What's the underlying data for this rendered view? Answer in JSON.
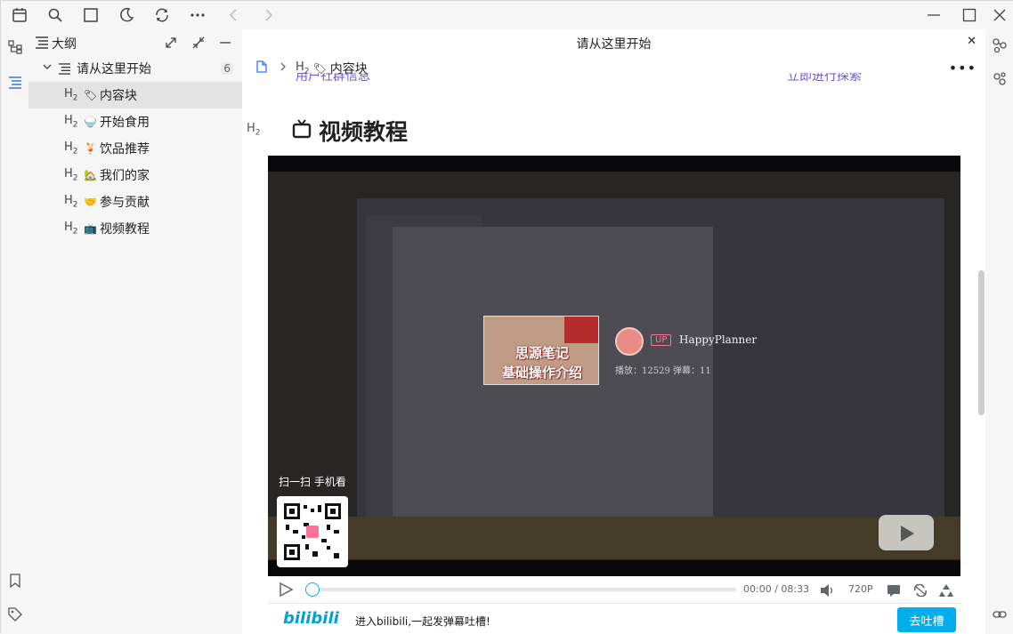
{
  "toolbar": {
    "icons": [
      "calendar-icon",
      "search-icon",
      "square-icon",
      "moon-icon",
      "sync-icon",
      "more-icon",
      "back-icon",
      "forward-icon"
    ]
  },
  "outline": {
    "title": "大纲",
    "root": {
      "label": "请从这里开始",
      "count": "6"
    },
    "items": [
      {
        "emoji": "🏷",
        "label": "内容块"
      },
      {
        "emoji": "🍚",
        "label": "开始食用"
      },
      {
        "emoji": "🍹",
        "label": "饮品推荐"
      },
      {
        "emoji": "🏡",
        "label": "我们的家"
      },
      {
        "emoji": "🤝",
        "label": "参与贡献"
      },
      {
        "emoji": "📺",
        "label": "视频教程"
      }
    ]
  },
  "editor": {
    "tab_title": "请从这里开始",
    "breadcrumb_item": "内容块",
    "heading": "视频教程",
    "cut_left": "用户社群信息",
    "cut_right": "立即进行探索"
  },
  "video": {
    "thumb_line1": "思源笔记",
    "thumb_line2": "基础操作介绍",
    "up_badge": "UP",
    "up_name": "HappyPlanner",
    "stats": "播放：12529   弹幕：11",
    "scan_label": "扫一扫 手机看",
    "time_current": "00:00",
    "time_sep": "/",
    "time_total": "08:33",
    "quality": "720P"
  },
  "bili": {
    "logo": "bilibili",
    "prompt": "进入bilibili,一起发弹幕吐槽!",
    "button": "去吐槽"
  },
  "colors": {
    "accent": "#3575f0",
    "bili_blue": "#00aeec",
    "bili_pink": "#fb7299"
  }
}
